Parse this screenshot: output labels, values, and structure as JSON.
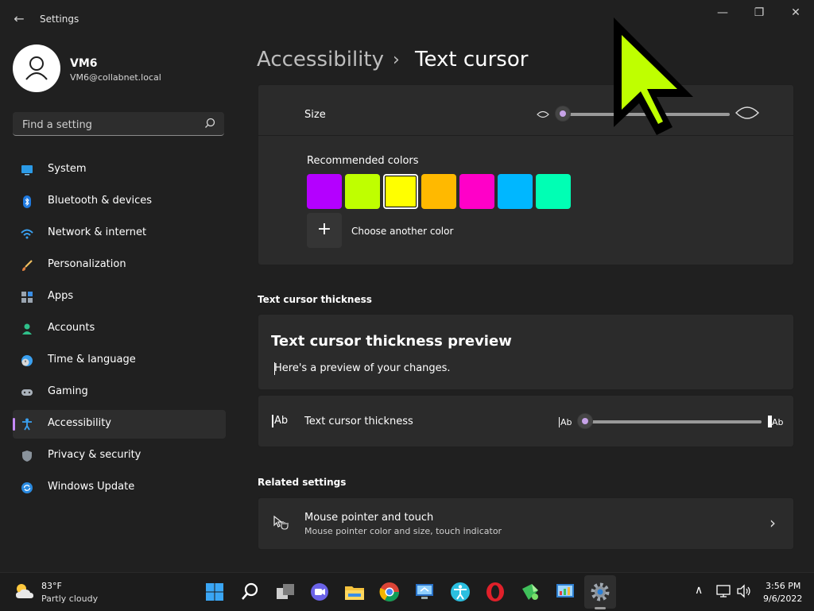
{
  "window": {
    "title": "Settings",
    "back_glyph": "←",
    "minimize_glyph": "—",
    "restore_glyph": "❐",
    "close_glyph": "✕"
  },
  "user": {
    "name": "VM6",
    "email": "VM6@collabnet.local"
  },
  "search": {
    "placeholder": "Find a setting"
  },
  "sidebar": {
    "items": [
      {
        "label": "System",
        "icon": "monitor-icon"
      },
      {
        "label": "Bluetooth & devices",
        "icon": "bluetooth-icon"
      },
      {
        "label": "Network & internet",
        "icon": "wifi-icon"
      },
      {
        "label": "Personalization",
        "icon": "brush-icon"
      },
      {
        "label": "Apps",
        "icon": "apps-icon"
      },
      {
        "label": "Accounts",
        "icon": "person-icon"
      },
      {
        "label": "Time & language",
        "icon": "clock-globe-icon"
      },
      {
        "label": "Gaming",
        "icon": "gamepad-icon"
      },
      {
        "label": "Accessibility",
        "icon": "accessibility-icon",
        "active": true
      },
      {
        "label": "Privacy & security",
        "icon": "shield-icon"
      },
      {
        "label": "Windows Update",
        "icon": "update-icon"
      }
    ]
  },
  "breadcrumb": {
    "parent": "Accessibility",
    "separator": "›",
    "current": "Text cursor"
  },
  "indicator": {
    "size_label": "Size",
    "size_level": 0.0,
    "recommended_colors_label": "Recommended colors",
    "colors": [
      "#b400ff",
      "#bfff00",
      "#ffff00",
      "#ffb900",
      "#ff00c8",
      "#00b7ff",
      "#00ffb4"
    ],
    "selected_color_index": 2,
    "choose_color_glyph": "+",
    "choose_color_label": "Choose another color"
  },
  "thickness": {
    "section_title": "Text cursor thickness",
    "preview_title": "Text cursor thickness preview",
    "preview_text": "Here's a preview of your changes.",
    "row_label": "Text cursor thickness",
    "min_label": "Ab",
    "max_label": "Ab",
    "level": 0.0,
    "row_icon_text": "Ab"
  },
  "related": {
    "section_title": "Related settings",
    "item_title": "Mouse pointer and touch",
    "item_subtitle": "Mouse pointer color and size, touch indicator",
    "chevron_glyph": "›"
  },
  "taskbar": {
    "weather_temp": "83°F",
    "weather_desc": "Partly cloudy",
    "time": "3:56 PM",
    "date": "9/6/2022",
    "tray_up_glyph": "∧",
    "pinned": [
      "start-icon",
      "search-icon",
      "task-view-icon",
      "chat-icon",
      "file-explorer-icon",
      "chrome-icon",
      "remote-desktop-icon",
      "accessibility-app-icon",
      "opera-icon",
      "sticky-app-icon",
      "control-panel-icon",
      "settings-icon"
    ]
  },
  "colors": {
    "accent": "#c58af9",
    "background": "#202020",
    "card": "#2b2b2b",
    "cursor_indicator": "#bfff00"
  }
}
